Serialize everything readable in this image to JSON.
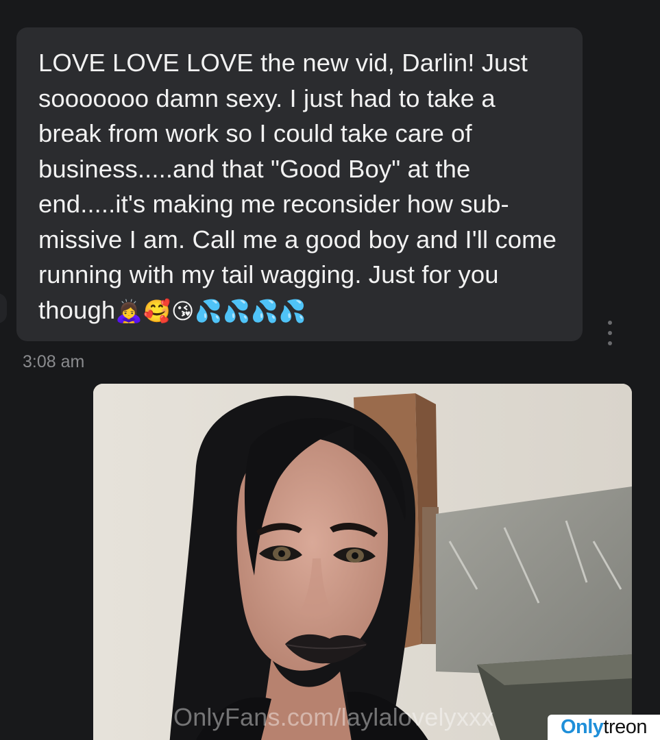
{
  "message": {
    "text": "LOVE LOVE LOVE the new vid, Darlin! Just sooooooo damn sexy. I just had to take a break from work so I could take care of business.....and that \"Good Boy\" at the end.....it's making me reconsider how sub-missive I am. Call me a good boy and I'll come running with my tail wagging. Just for you though",
    "emojis": "🙇‍♀️🥰😘💦💦💦💦",
    "timestamp": "3:08 am"
  },
  "attachment": {
    "watermark": "OnlyFans.com/laylalovelyxxx"
  },
  "badge": {
    "brand_part1": "Only",
    "brand_part2": "treon"
  },
  "icons": {
    "more_menu": "more-vertical-icon"
  },
  "colors": {
    "background": "#18191b",
    "bubble": "#2b2c2f",
    "text": "#f2f2f2",
    "timestamp": "#8a8b8e",
    "badge_accent": "#1f8fd9"
  }
}
